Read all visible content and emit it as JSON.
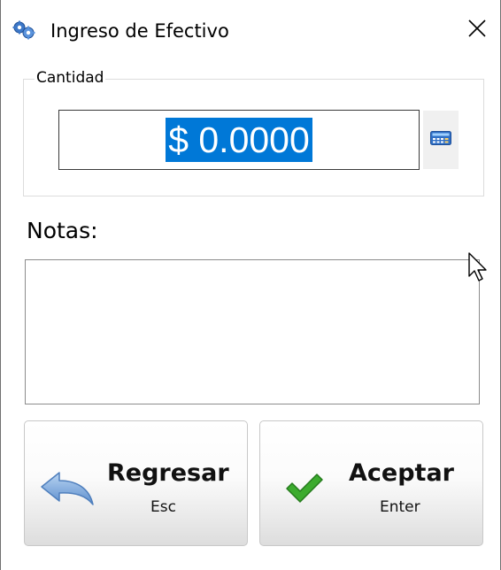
{
  "window": {
    "title": "Ingreso de Efectivo",
    "app_icon": "gears-icon",
    "close_icon": "close-icon"
  },
  "amount_group": {
    "label": "Cantidad",
    "value": "$ 0.0000",
    "calculator_icon": "calculator-icon"
  },
  "notes": {
    "label": "Notas:",
    "value": ""
  },
  "buttons": {
    "back": {
      "label": "Regresar",
      "shortcut": "Esc",
      "icon": "back-arrow-icon"
    },
    "accept": {
      "label": "Aceptar",
      "shortcut": "Enter",
      "icon": "checkmark-icon"
    }
  },
  "colors": {
    "selection": "#0078d7",
    "check_green": "#3cab2e",
    "arrow_blue": "#6d9fd4"
  }
}
